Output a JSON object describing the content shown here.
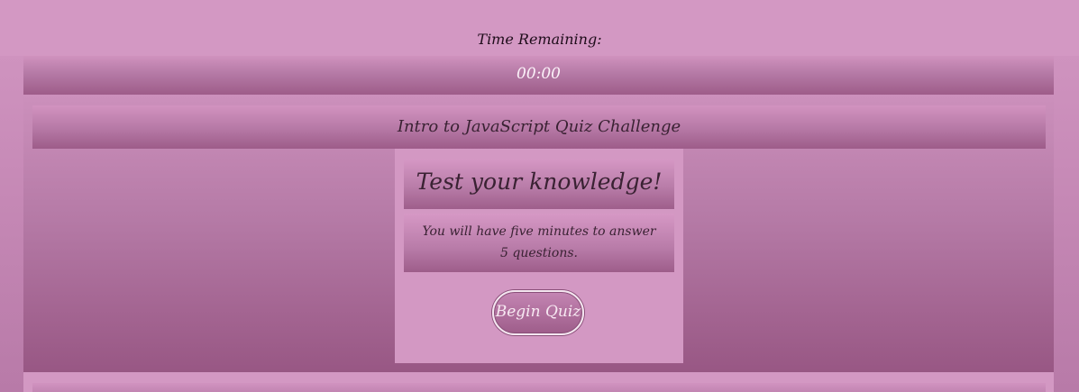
{
  "timer": {
    "label": "Time Remaining:",
    "value": "00:00"
  },
  "header": {
    "title": "Intro to JavaScript Quiz Challenge"
  },
  "intro_card": {
    "heading": "Test your knowledge!",
    "description": "You will have five minutes to answer 5 questions.",
    "begin_label": "Begin Quiz"
  },
  "colors": {
    "background": "#d398c3",
    "panel_dark": "#985784",
    "text_dark": "#3a2233",
    "text_light": "#fbf1f8"
  }
}
